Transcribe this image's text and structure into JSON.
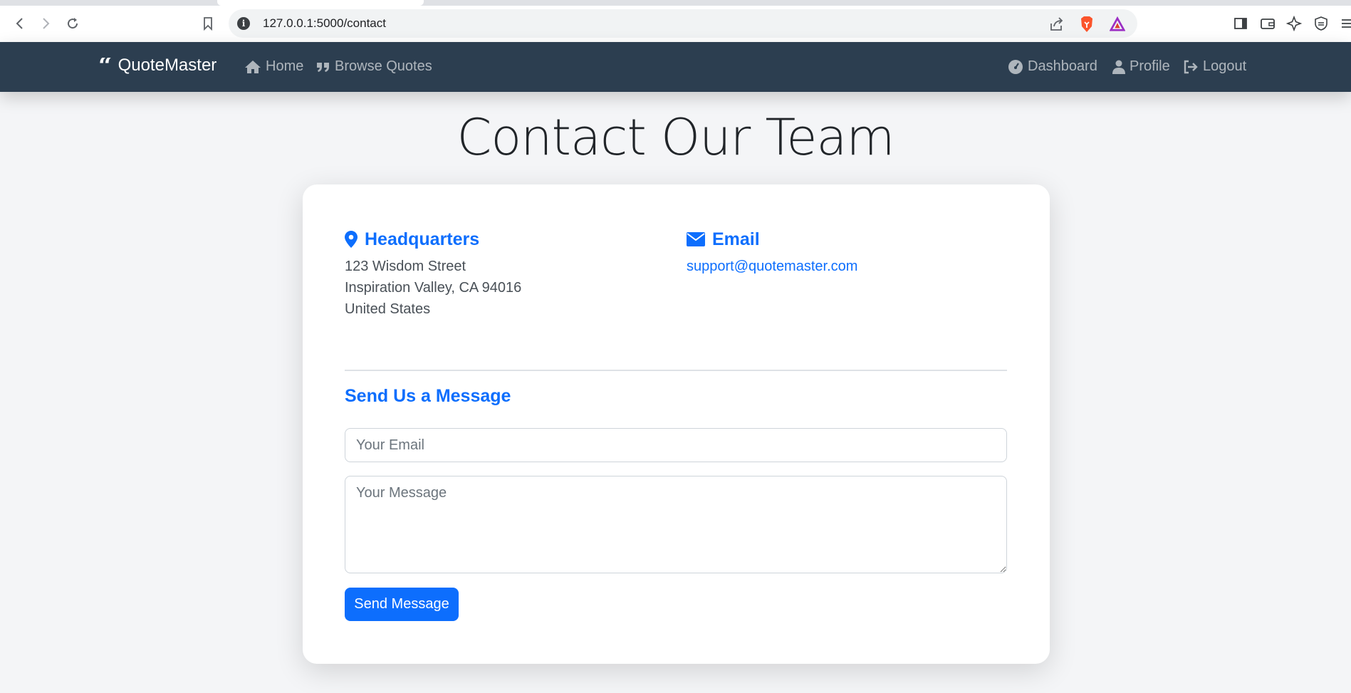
{
  "browser": {
    "url": "127.0.0.1:5000/contact"
  },
  "navbar": {
    "brand": "QuoteMaster",
    "left_links": [
      "Home",
      "Browse Quotes"
    ],
    "right_links": [
      "Dashboard",
      "Profile",
      "Logout"
    ]
  },
  "page": {
    "title": "Contact Our Team"
  },
  "headquarters": {
    "heading": "Headquarters",
    "lines": [
      "123 Wisdom Street",
      "Inspiration Valley, CA 94016",
      "United States"
    ]
  },
  "email_info": {
    "heading": "Email",
    "address": "support@quotemaster.com"
  },
  "form": {
    "title": "Send Us a Message",
    "email_placeholder": "Your Email",
    "message_placeholder": "Your Message",
    "submit_label": "Send Message"
  },
  "colors": {
    "navbar_bg": "#2c3e50",
    "accent": "#0d6efd"
  }
}
